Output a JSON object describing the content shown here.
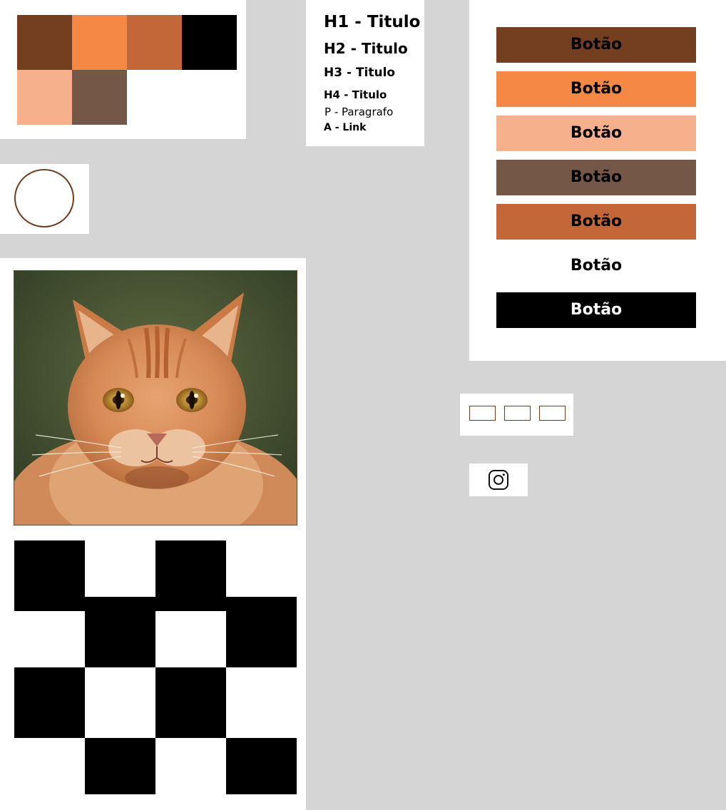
{
  "palette": {
    "colors": [
      "#743e20",
      "#f58844",
      "#c36738",
      "#000000",
      "#f6b08b",
      "#745747"
    ]
  },
  "typography": {
    "h1": "H1 - Titulo",
    "h2": "H2 - Titulo",
    "h3": "H3 - Titulo",
    "h4": "H4 - Titulo",
    "p": "P - Paragrafo",
    "a": "A - Link"
  },
  "buttons": [
    {
      "label": "Botão",
      "background": "#743e20",
      "text_color": "#000000"
    },
    {
      "label": "Botão",
      "background": "#f58844",
      "text_color": "#000000"
    },
    {
      "label": "Botão",
      "background": "#f6b08b",
      "text_color": "#000000"
    },
    {
      "label": "Botão",
      "background": "#745747",
      "text_color": "#000000"
    },
    {
      "label": "Botão",
      "background": "#c36738",
      "text_color": "#000000"
    },
    {
      "label": "Botão",
      "background": "#ffffff",
      "text_color": "#000000"
    },
    {
      "label": "Botão",
      "background": "#000000",
      "text_color": "#ffffff"
    }
  ],
  "media": {
    "image_subject": "orange-tabby-cat-photo"
  },
  "social": {
    "icon": "instagram-icon"
  }
}
